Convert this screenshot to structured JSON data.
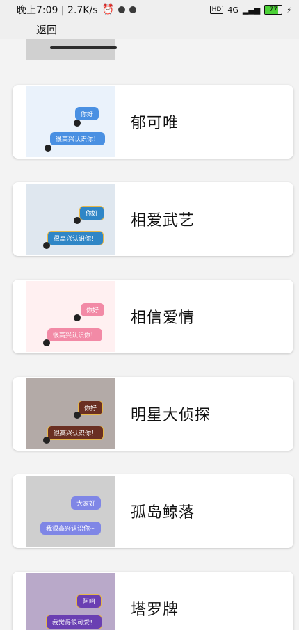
{
  "status_bar": {
    "time": "晚上7:09 | 2.7K/s",
    "network": "4G",
    "battery": "77"
  },
  "header": {
    "back_label": "返回"
  },
  "themes": [
    {
      "name": "郁可唯",
      "bg": "#eaf2fb",
      "bubble1": "你好",
      "bubble2": "很高兴认识你！",
      "color": "#4a90e2"
    },
    {
      "name": "相爱武艺",
      "bg": "#dfe7ef",
      "bubble1": "你好",
      "bubble2": "很高兴认识你！",
      "color": "#2f86c6"
    },
    {
      "name": "相信爱情",
      "bg": "#fff0f1",
      "bubble1": "你好",
      "bubble2": "很高兴认识你！",
      "color": "#f28aa6"
    },
    {
      "name": "明星大侦探",
      "bg": "#b3aaa7",
      "bubble1": "你好",
      "bubble2": "很高兴认识你！",
      "color": "#6a2f22"
    },
    {
      "name": "孤岛鲸落",
      "bg": "#cfcfcf",
      "bubble1": "大家好",
      "bubble2": "我很高兴认识你~",
      "color": "#7f86e6"
    },
    {
      "name": "塔罗牌",
      "bg": "#b9a9c9",
      "bubble1": "阿呵",
      "bubble2": "我觉得很可爱！",
      "color": "#6a3fb2"
    }
  ]
}
